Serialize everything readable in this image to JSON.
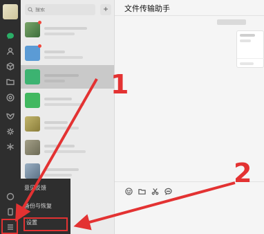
{
  "search": {
    "placeholder": "搜索"
  },
  "add_button": {
    "label": "+"
  },
  "chat": {
    "title": "文件传输助手"
  },
  "menu": {
    "items": [
      {
        "label": "意见反馈"
      },
      {
        "label": "备份与恢复"
      },
      {
        "label": "设置"
      }
    ]
  },
  "annotations": {
    "num1": "1",
    "num2": "2"
  },
  "colors": {
    "accent_green": "#2aae67",
    "annotation_red": "#e33232"
  }
}
